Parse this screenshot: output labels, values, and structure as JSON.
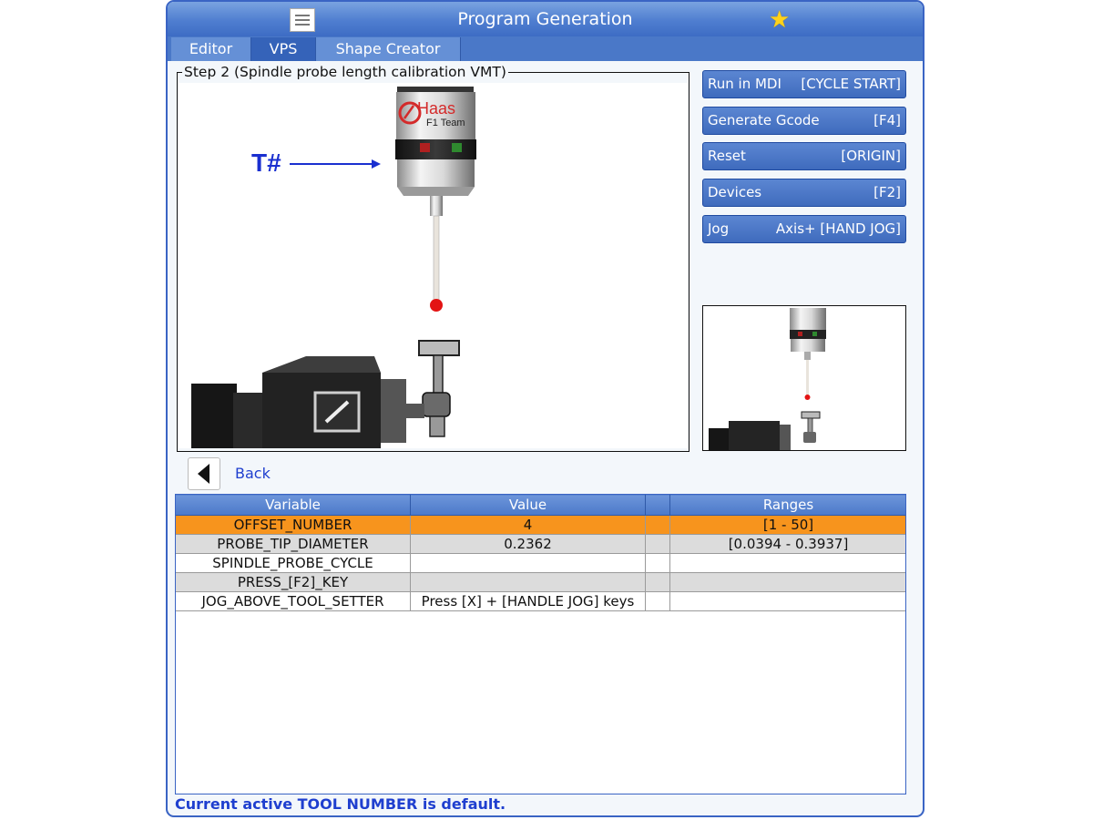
{
  "window": {
    "title": "Program Generation"
  },
  "icons": {
    "menu": "hamburger-menu-icon",
    "favorite": "star-icon",
    "back": "left-arrow-icon"
  },
  "tabs": [
    {
      "label": "Editor",
      "active": false
    },
    {
      "label": "VPS",
      "active": true
    },
    {
      "label": "Shape Creator",
      "active": false
    }
  ],
  "step": {
    "title": "Step 2 (Spindle probe length calibration VMT)",
    "annotation": "T#",
    "probe_logo_text": "Haas",
    "probe_logo_subtext": "F1 Team"
  },
  "actions": [
    {
      "label": "Run in MDI",
      "key": "[CYCLE START]"
    },
    {
      "label": "Generate Gcode",
      "key": "[F4]"
    },
    {
      "label": "Reset",
      "key": "[ORIGIN]"
    },
    {
      "label": "Devices",
      "key": "[F2]"
    },
    {
      "label": "Jog",
      "key": "Axis+ [HAND JOG]"
    }
  ],
  "navigation": {
    "back_label": "Back"
  },
  "table": {
    "headers": [
      "Variable",
      "Value",
      "",
      "Ranges"
    ],
    "rows": [
      {
        "variable": "OFFSET_NUMBER",
        "value": "4",
        "extra": "",
        "range": "[1 - 50]",
        "selected": true
      },
      {
        "variable": "PROBE_TIP_DIAMETER",
        "value": "0.2362",
        "extra": "",
        "range": "[0.0394 - 0.3937]"
      },
      {
        "variable": "SPINDLE_PROBE_CYCLE",
        "value": "",
        "extra": "",
        "range": ""
      },
      {
        "variable": "PRESS_[F2]_KEY",
        "value": "",
        "extra": "",
        "range": ""
      },
      {
        "variable": "JOG_ABOVE_TOOL_SETTER",
        "value": "Press [X] + [HANDLE JOG] keys",
        "extra": "",
        "range": ""
      }
    ]
  },
  "status": {
    "message": "Current active TOOL NUMBER is default."
  },
  "colors": {
    "accent": "#4a78c8",
    "selected_row": "#f7941d",
    "alt_row": "#dcdcdc",
    "status_text": "#1f3fcf",
    "annotation": "#1a2fd0"
  }
}
